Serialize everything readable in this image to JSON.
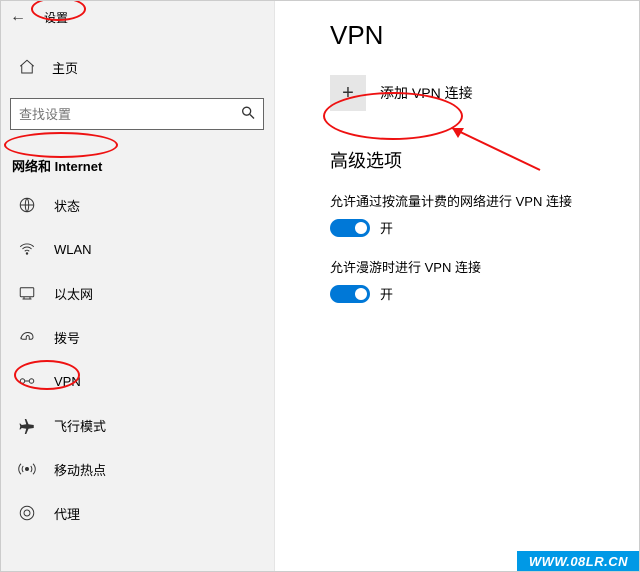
{
  "topbar": {
    "title": "设置"
  },
  "home": {
    "label": "主页"
  },
  "search": {
    "placeholder": "查找设置"
  },
  "section_header": "网络和 Internet",
  "nav": [
    {
      "label": "状态"
    },
    {
      "label": "WLAN"
    },
    {
      "label": "以太网"
    },
    {
      "label": "拨号"
    },
    {
      "label": "VPN"
    },
    {
      "label": "飞行模式"
    },
    {
      "label": "移动热点"
    },
    {
      "label": "代理"
    }
  ],
  "main": {
    "title": "VPN",
    "add_label": "添加 VPN 连接",
    "advanced_title": "高级选项",
    "options": [
      {
        "label": "允许通过按流量计费的网络进行 VPN 连接",
        "state_text": "开",
        "on": true
      },
      {
        "label": "允许漫游时进行 VPN 连接",
        "state_text": "开",
        "on": true
      }
    ]
  },
  "watermark": "WWW.08LR.CN"
}
